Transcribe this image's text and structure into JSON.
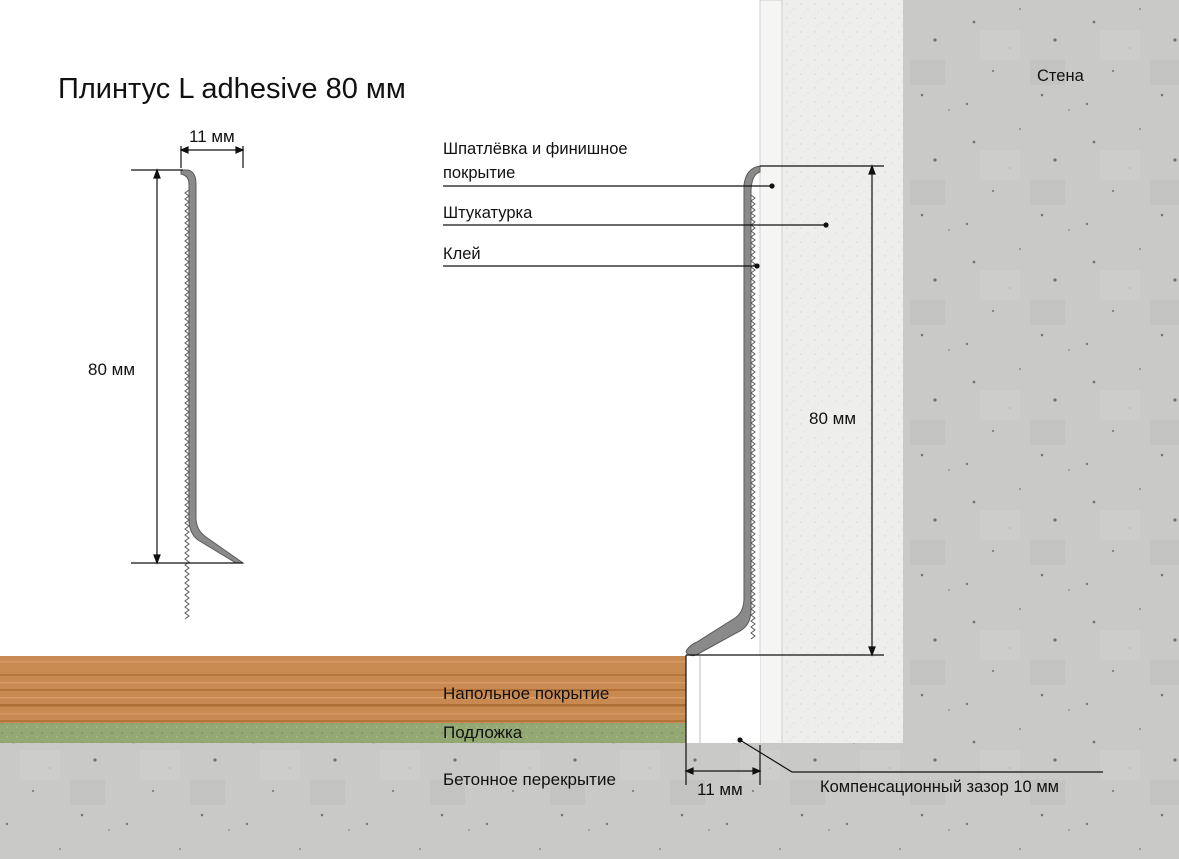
{
  "title": "Плинтус L adhesive 80 мм",
  "wall_label": "Стена",
  "detail": {
    "width_label": "11 мм",
    "height_label": "80 мм"
  },
  "callouts": {
    "putty": [
      "Шпатлёвка и финишное",
      "покрытие"
    ],
    "plaster": "Штукатурка",
    "glue": "Клей"
  },
  "installed": {
    "height_label": "80 мм",
    "width_label": "11 мм"
  },
  "floor_layers": {
    "covering": "Напольное покрытие",
    "underlay": "Подложка",
    "slab": "Бетонное перекрытие"
  },
  "gap_label": "Компенсационный зазор 10 мм",
  "colors": {
    "concrete": "#c9c9c7",
    "plaster": "#eeeeec",
    "wood": "#c98a52",
    "underlay": "#93a872",
    "profile": "#8a8a8a"
  }
}
